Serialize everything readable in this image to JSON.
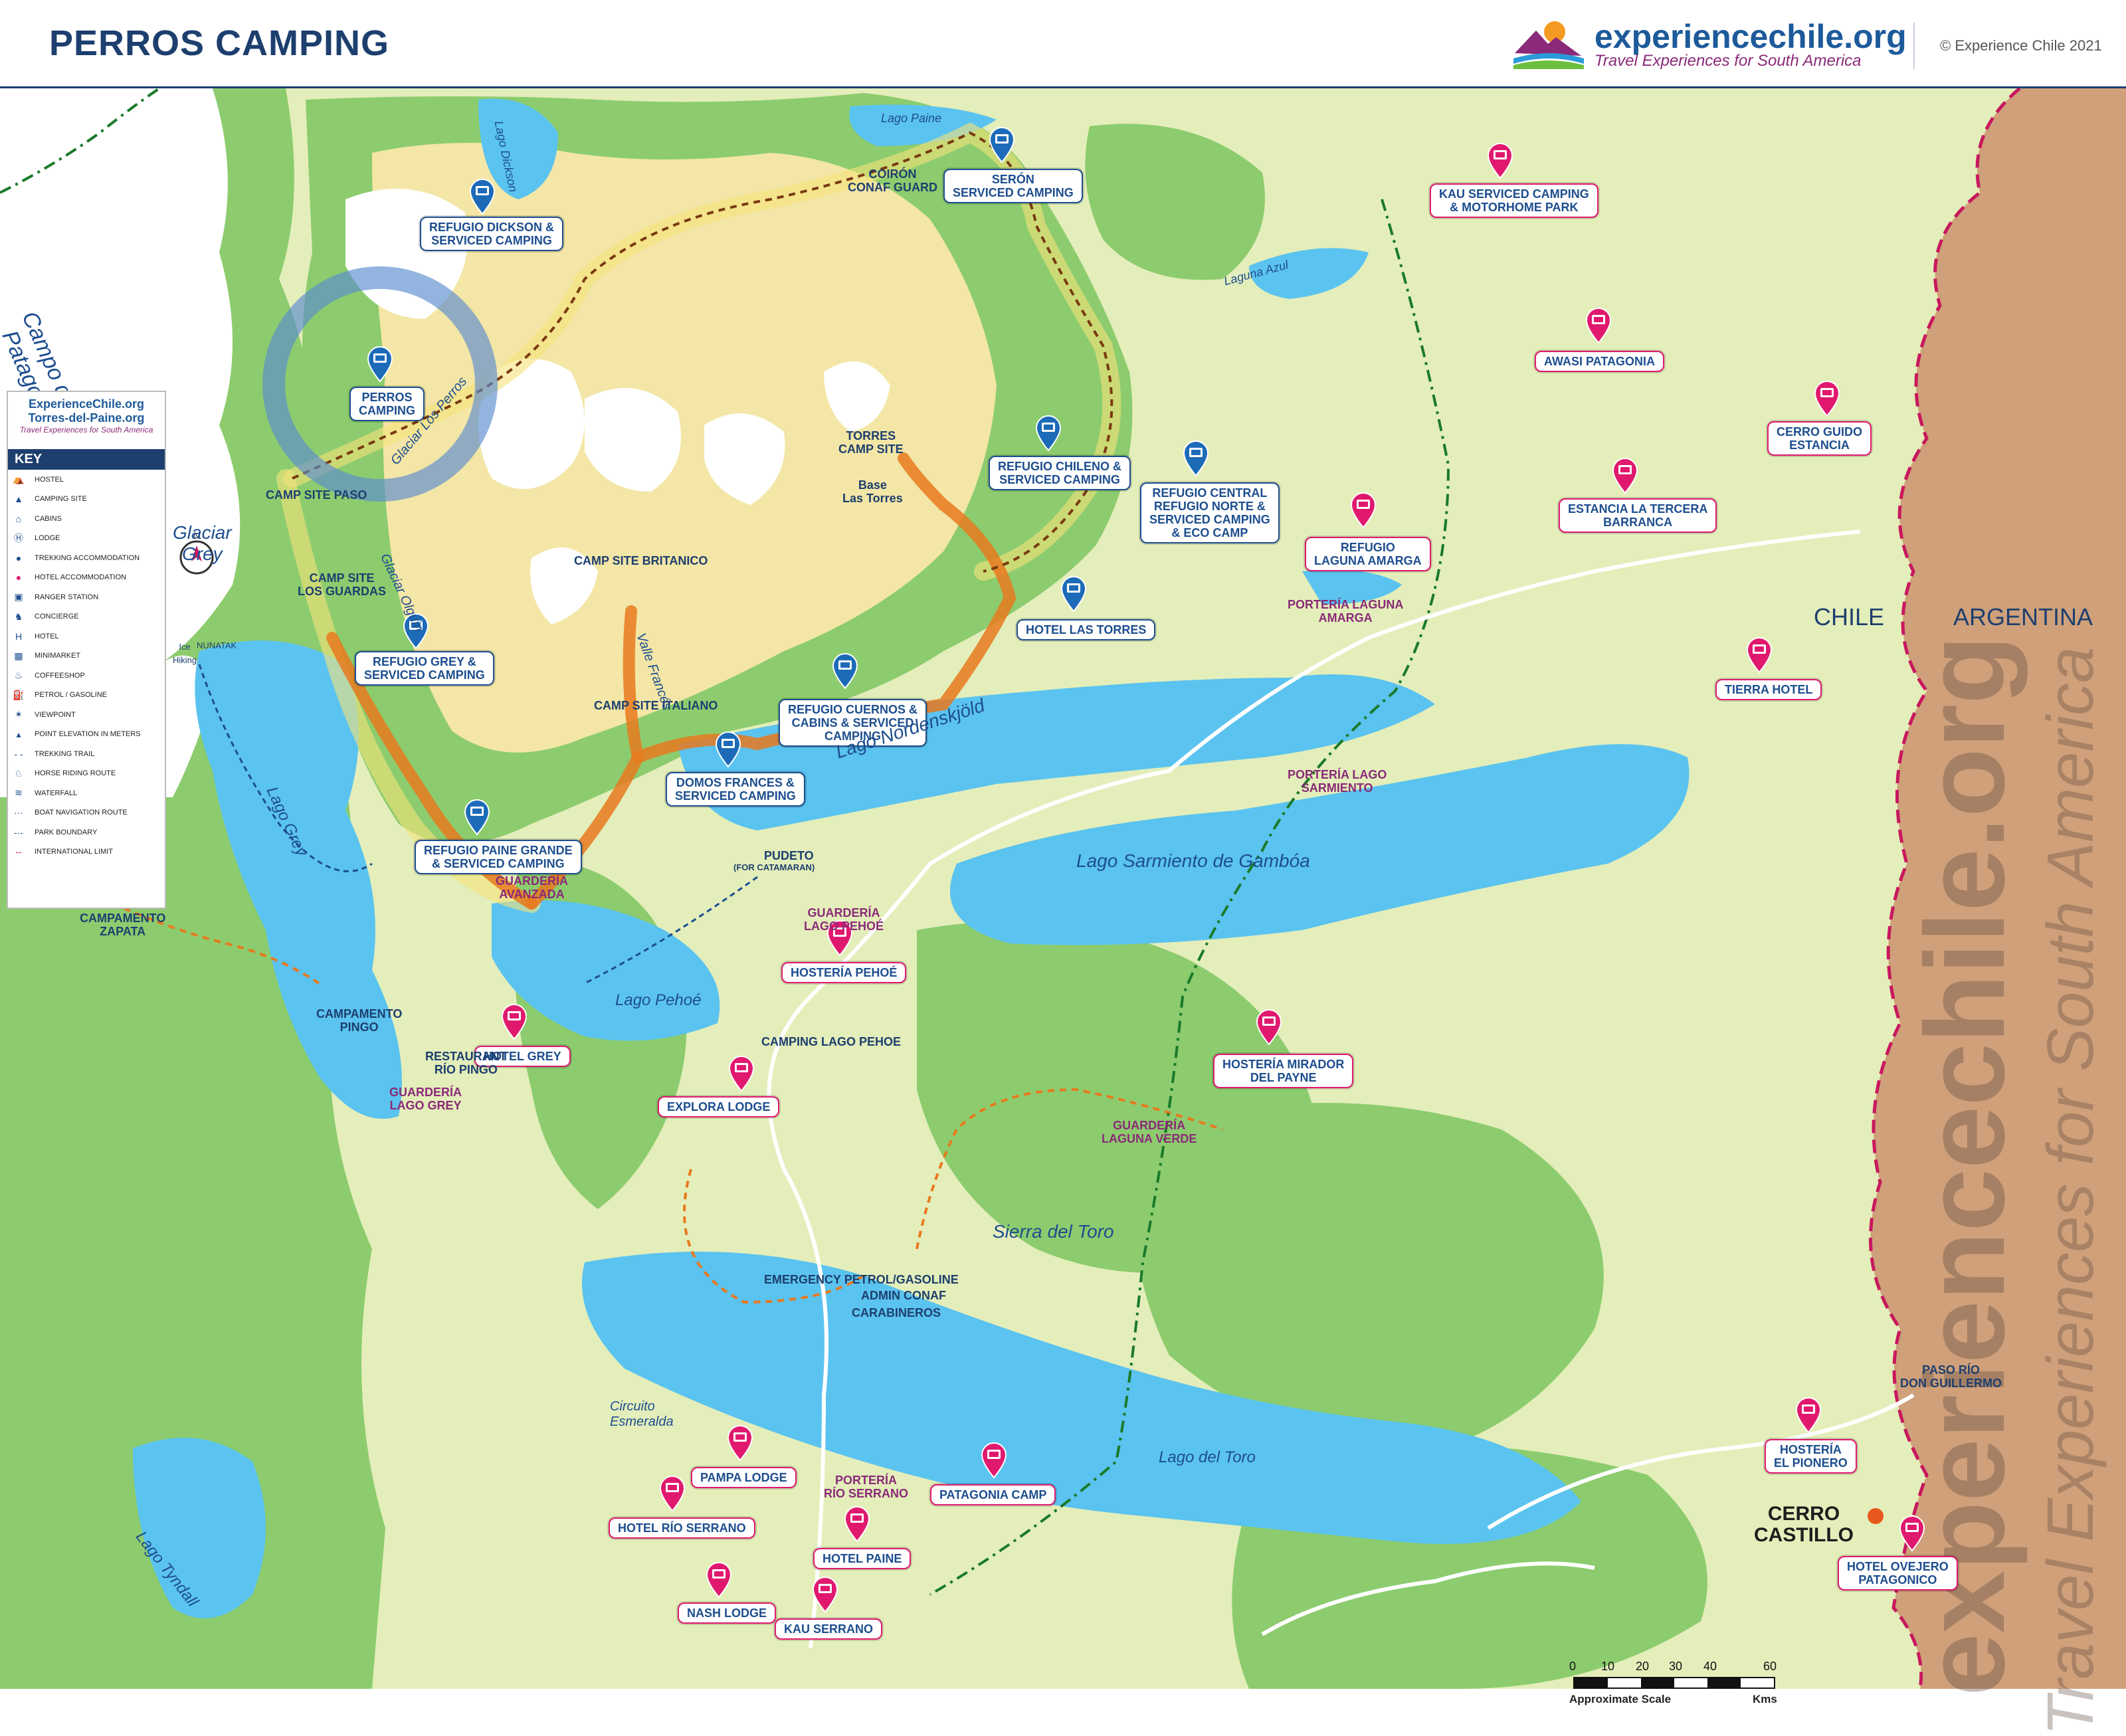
{
  "header": {
    "title": "PERROS CAMPING",
    "brand": "experiencechile.org",
    "tagline": "Travel Experiences for South America",
    "copyright": "© Experience Chile 2021"
  },
  "colors": {
    "ice": "#ffffff",
    "rock": "#f3e6a6",
    "forest": "#8ccc6e",
    "light_land": "#e4eeba",
    "lake": "#5bc3ef",
    "argentina_land": "#cfa07a",
    "trail_highlight": "#e8791e",
    "marker_blue": "#1d6bb8",
    "marker_pink": "#e0196e",
    "navy": "#1d3f6e"
  },
  "legend": {
    "logo_line1": "ExperienceChile.org",
    "logo_line2": "Torres-del-Paine.org",
    "logo_tagline": "Travel Experiences for South America",
    "heading": "KEY",
    "items": [
      {
        "icon": "hostel-icon",
        "label": "HOSTEL"
      },
      {
        "icon": "camping-site-icon",
        "label": "CAMPING SITE"
      },
      {
        "icon": "cabins-icon",
        "label": "CABINS"
      },
      {
        "icon": "lodge-icon",
        "label": "LODGE"
      },
      {
        "icon": "trekking-accommodation-icon",
        "label": "TREKKING ACCOMMODATION"
      },
      {
        "icon": "hotel-accommodation-icon",
        "label": "HOTEL ACCOMMODATION"
      },
      {
        "icon": "ranger-station-icon",
        "label": "RANGER STATION"
      },
      {
        "icon": "concierge-icon",
        "label": "CONCIERGE"
      },
      {
        "icon": "hotel-icon",
        "label": "HOTEL"
      },
      {
        "icon": "minimarket-icon",
        "label": "MINIMARKET"
      },
      {
        "icon": "coffeeshop-icon",
        "label": "COFFEESHOP"
      },
      {
        "icon": "petrol-icon",
        "label": "PETROL / GASOLINE"
      },
      {
        "icon": "viewpoint-icon",
        "label": "VIEWPOINT"
      },
      {
        "icon": "point-elevation-icon",
        "label": "POINT ELEVATION IN METERS"
      },
      {
        "icon": "trekking-trail-icon",
        "label": "TREKKING TRAIL"
      },
      {
        "icon": "horse-riding-icon",
        "label": "HORSE RIDING ROUTE"
      },
      {
        "icon": "waterfall-icon",
        "label": "WATERFALL"
      },
      {
        "icon": "boat-route-icon",
        "label": "BOAT NAVIGATION ROUTE"
      },
      {
        "icon": "park-boundary-icon",
        "label": "PARK BOUNDARY"
      },
      {
        "icon": "international-limit-icon",
        "label": "INTERNATIONAL LIMIT"
      }
    ]
  },
  "blue_labels": [
    {
      "name": "refugio-dickson",
      "text": "REFUGIO DICKSON &\nSERVICED CAMPING"
    },
    {
      "name": "seron",
      "text": "SERÓN\nSERVICED CAMPING"
    },
    {
      "name": "perros-camping",
      "text": "PERROS\nCAMPING"
    },
    {
      "name": "refugio-chileno",
      "text": "REFUGIO CHILENO &\nSERVICED CAMPING"
    },
    {
      "name": "refugio-central",
      "text": "REFUGIO CENTRAL\nREFUGIO NORTE &\nSERVICED CAMPING\n& ECO CAMP"
    },
    {
      "name": "hotel-las-torres",
      "text": "HOTEL LAS TORRES"
    },
    {
      "name": "refugio-grey",
      "text": "REFUGIO GREY &\nSERVICED CAMPING"
    },
    {
      "name": "refugio-cuernos",
      "text": "REFUGIO CUERNOS &\nCABINS & SERVICED\nCAMPING"
    },
    {
      "name": "domos-frances",
      "text": "DOMOS FRANCES &\nSERVICED CAMPING"
    },
    {
      "name": "refugio-paine-grande",
      "text": "REFUGIO PAINE GRANDE\n& SERVICED CAMPING"
    }
  ],
  "pink_labels": [
    {
      "name": "kau-serviced-camping",
      "text": "KAU SERVICED CAMPING\n& MOTORHOME PARK"
    },
    {
      "name": "awasi-patagonia",
      "text": "AWASI PATAGONIA"
    },
    {
      "name": "cerro-guido",
      "text": "CERRO GUIDO\nESTANCIA"
    },
    {
      "name": "estancia-la-tercera",
      "text": "ESTANCIA LA TERCERA\nBARRANCA"
    },
    {
      "name": "refugio-laguna-amarga",
      "text": "REFUGIO\nLAGUNA AMARGA"
    },
    {
      "name": "tierra-hotel",
      "text": "TIERRA HOTEL"
    },
    {
      "name": "hosteria-pehoe",
      "text": "HOSTERÍA PEHOÉ"
    },
    {
      "name": "hotel-grey",
      "text": "HOTEL GREY"
    },
    {
      "name": "explora-lodge",
      "text": "EXPLORA LODGE"
    },
    {
      "name": "hosteria-mirador",
      "text": "HOSTERÍA MIRADOR\nDEL PAYNE"
    },
    {
      "name": "pampa-lodge",
      "text": "PAMPA LODGE"
    },
    {
      "name": "patagonia-camp",
      "text": "PATAGONIA CAMP"
    },
    {
      "name": "hotel-rio-serrano",
      "text": "HOTEL RÍO SERRANO"
    },
    {
      "name": "hotel-paine",
      "text": "HOTEL PAINE"
    },
    {
      "name": "nash-lodge",
      "text": "NASH LODGE"
    },
    {
      "name": "kau-serrano",
      "text": "KAU SERRANO"
    },
    {
      "name": "hosteria-el-pionero",
      "text": "HOSTERÍA\nEL PIONERO"
    },
    {
      "name": "hotel-ovejero",
      "text": "HOTEL OVEJERO\nPATAGONICO"
    }
  ],
  "place_labels": [
    {
      "name": "camp-site-paso",
      "text": "CAMP SITE PASO"
    },
    {
      "name": "camp-site-los-guardas",
      "text": "CAMP SITE\nLOS GUARDAS"
    },
    {
      "name": "camp-site-britanico",
      "text": "CAMP SITE BRITANICO"
    },
    {
      "name": "camp-site-italiano",
      "text": "CAMP SITE ITALIANO"
    },
    {
      "name": "torres-camp-site",
      "text": "TORRES\nCAMP SITE"
    },
    {
      "name": "base-las-torres",
      "text": "Base\nLas Torres"
    },
    {
      "name": "coiron-conaf-guard",
      "text": "COIRÓN\nCONAF GUARD"
    },
    {
      "name": "campamento-zapata",
      "text": "CAMPAMENTO\nZAPATA"
    },
    {
      "name": "campamento-pingo",
      "text": "CAMPAMENTO\nPINGO"
    },
    {
      "name": "restaurant-rio-pingo",
      "text": "RESTAURANT\nRÍO PINGO"
    },
    {
      "name": "guarderia-lago-grey",
      "text": "GUARDERÍA\nLAGO GREY"
    },
    {
      "name": "guarderia-avanzada",
      "text": "GUARDERÍA\nAVANZADA"
    },
    {
      "name": "pudeto",
      "text": "PUDETO"
    },
    {
      "name": "pudeto-sub",
      "text": "(FOR CATAMARAN)"
    },
    {
      "name": "guarderia-lago-pehoe",
      "text": "GUARDERÍA\nLAGO PEHOÉ"
    },
    {
      "name": "camping-lago-pehoe",
      "text": "CAMPING LAGO PEHOE"
    },
    {
      "name": "guarderia-laguna-verde",
      "text": "GUARDERÍA\nLAGUNA VERDE"
    },
    {
      "name": "porteria-laguna-amarga",
      "text": "PORTERÍA LAGUNA\nAMARGA"
    },
    {
      "name": "porteria-lago-sarmiento",
      "text": "PORTERÍA LAGO\nSARMIENTO"
    },
    {
      "name": "emergency-petrol",
      "text": "EMERGENCY PETROL/GASOLINE"
    },
    {
      "name": "admin-conaf",
      "text": "ADMIN CONAF"
    },
    {
      "name": "carabineros",
      "text": "CARABINEROS"
    },
    {
      "name": "porteria-rio-serrano",
      "text": "PORTERÍA\nRÍO SERRANO"
    },
    {
      "name": "paso-rio-don-guillermo",
      "text": "PASO RÍO\nDON GUILLERMO"
    },
    {
      "name": "nunatak",
      "text": "NUNATAK"
    },
    {
      "name": "ice-hiking",
      "text": "Ice\nHiking"
    }
  ],
  "water_labels": [
    {
      "name": "lago-grey",
      "text": "Lago Grey"
    },
    {
      "name": "lago-pehoe",
      "text": "Lago Pehoé"
    },
    {
      "name": "lago-nordenskjold",
      "text": "Lago Nordenskjöld"
    },
    {
      "name": "lago-sarmiento",
      "text": "Lago Sarmiento de Gambóa"
    },
    {
      "name": "lago-del-toro",
      "text": "Lago del Toro"
    },
    {
      "name": "lago-tyndall",
      "text": "Lago Tyndall"
    },
    {
      "name": "laguna-azul",
      "text": "Laguna Azul"
    },
    {
      "name": "lago-dickson",
      "text": "Lago Dickson"
    },
    {
      "name": "lago-paine",
      "text": "Lago Paine"
    },
    {
      "name": "glaciar-grey",
      "text": "Glaciar\nGrey"
    },
    {
      "name": "glaciar-olguin",
      "text": "Glaciar Olguin"
    },
    {
      "name": "glaciar-los-perros",
      "text": "Glaciar Los Perros"
    },
    {
      "name": "valle-frances",
      "text": "Valle Francés"
    },
    {
      "name": "sierra-del-toro",
      "text": "Sierra del Toro"
    },
    {
      "name": "circuito-esmeralda",
      "text": "Circuito\nEsmeralda"
    }
  ],
  "region_labels": {
    "ice_field": "Campo de Hielo\nPatagonia Sur",
    "chile": "CHILE",
    "argentina": "ARGENTINA",
    "cerro_castillo": "CERRO\nCASTILLO"
  },
  "scale": {
    "ticks": [
      "0",
      "10",
      "20",
      "30",
      "40",
      "60"
    ],
    "caption": "Approximate Scale",
    "unit": "Kms"
  },
  "watermark": {
    "line1": "experiencechile.org",
    "line2": "Travel Experiences for South America"
  }
}
